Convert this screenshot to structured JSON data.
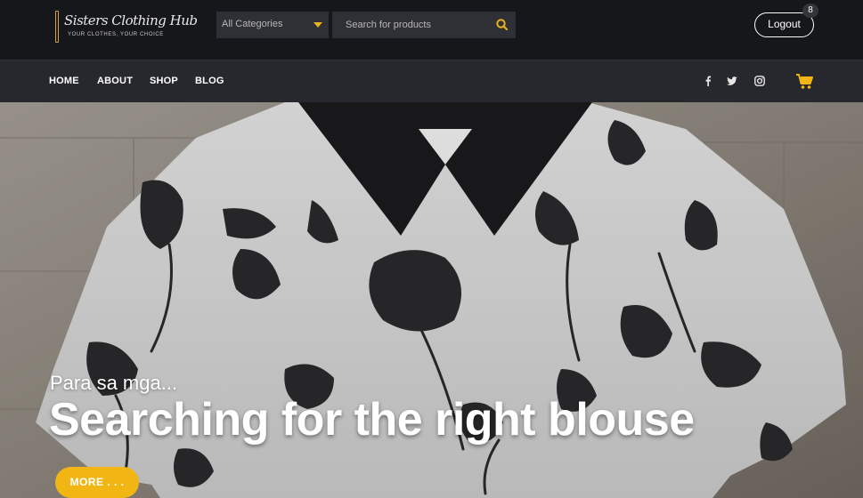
{
  "brand": {
    "name": "Sisters Clothing Hub",
    "tagline": "YOUR CLOTHES, YOUR CHOICE"
  },
  "header": {
    "category_select": {
      "selected": "All Categories"
    },
    "search": {
      "placeholder": "Search for products",
      "icon": "search-icon"
    },
    "logout_label": "Logout"
  },
  "nav": {
    "items": [
      {
        "label": "HOME"
      },
      {
        "label": "ABOUT"
      },
      {
        "label": "SHOP"
      },
      {
        "label": "BLOG"
      }
    ],
    "social": [
      "facebook-icon",
      "twitter-icon",
      "instagram-icon"
    ],
    "cart": {
      "count": "8",
      "icon": "cart-icon"
    }
  },
  "hero": {
    "subtitle": "Para sa mga...",
    "title": "Searching for the right blouse",
    "button_label": "MORE . . ."
  },
  "colors": {
    "accent": "#f2b614",
    "topbar": "#16171b",
    "navbar": "#27282d"
  }
}
